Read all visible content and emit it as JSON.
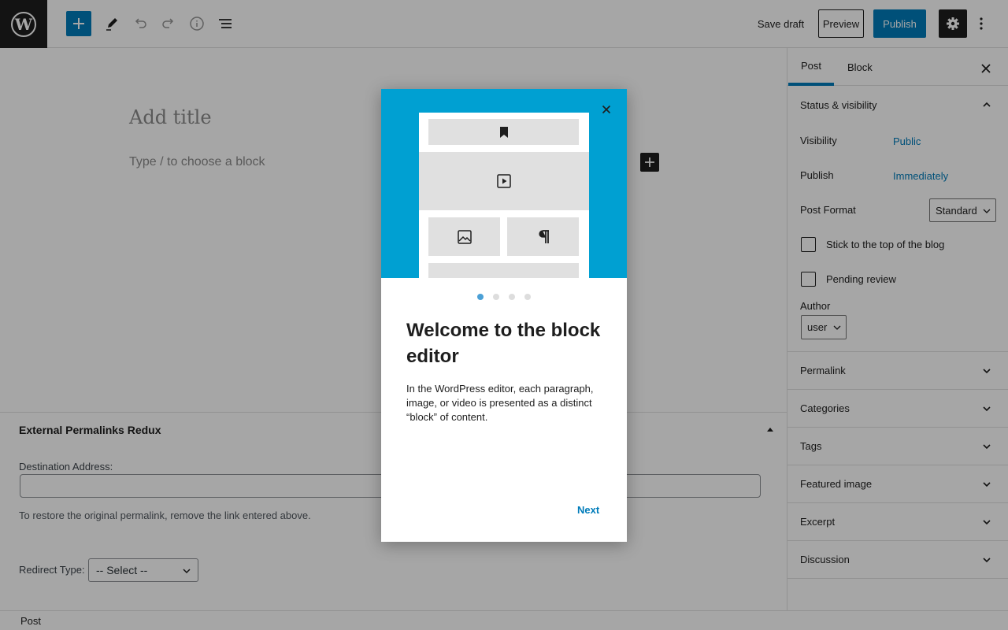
{
  "topbar": {
    "logo_icon": "wordpress-logo",
    "icons": [
      "plus-icon",
      "pencil-icon",
      "undo-icon",
      "redo-icon",
      "info-icon",
      "list-view-icon"
    ],
    "save_draft_label": "Save draft",
    "preview_label": "Preview",
    "publish_label": "Publish",
    "settings_icon": "gear-icon",
    "more_icon": "more-vertical-icon"
  },
  "editor": {
    "title_placeholder": "Add title",
    "block_placeholder": "Type / to choose a block"
  },
  "metabox": {
    "title": "External Permalinks Redux",
    "destination_label": "Destination Address:",
    "destination_value": "",
    "help_text": "To restore the original permalink, remove the link entered above.",
    "redirect_label": "Redirect Type:",
    "redirect_selected": "-- Select --"
  },
  "footer": {
    "breadcrumb": "Post"
  },
  "sidebar": {
    "tabs": [
      "Post",
      "Block"
    ],
    "status_title": "Status & visibility",
    "visibility_label": "Visibility",
    "visibility_value": "Public",
    "publish_label": "Publish",
    "publish_value": "Immediately",
    "post_format_label": "Post Format",
    "post_format_value": "Standard",
    "sticky_label": "Stick to the top of the blog",
    "pending_label": "Pending review",
    "author_label": "Author",
    "author_value": "user",
    "panels": [
      "Permalink",
      "Categories",
      "Tags",
      "Featured image",
      "Excerpt",
      "Discussion"
    ]
  },
  "modal": {
    "heading": "Welcome to the block editor",
    "text": "In the WordPress editor, each paragraph, image, or video is presented as a distinct “block” of content.",
    "next_label": "Next",
    "page_count": 4,
    "active_page": 1,
    "accent_color": "#00a0d2"
  },
  "colors": {
    "accent": "#007cba",
    "dark": "#1e1e1e"
  }
}
